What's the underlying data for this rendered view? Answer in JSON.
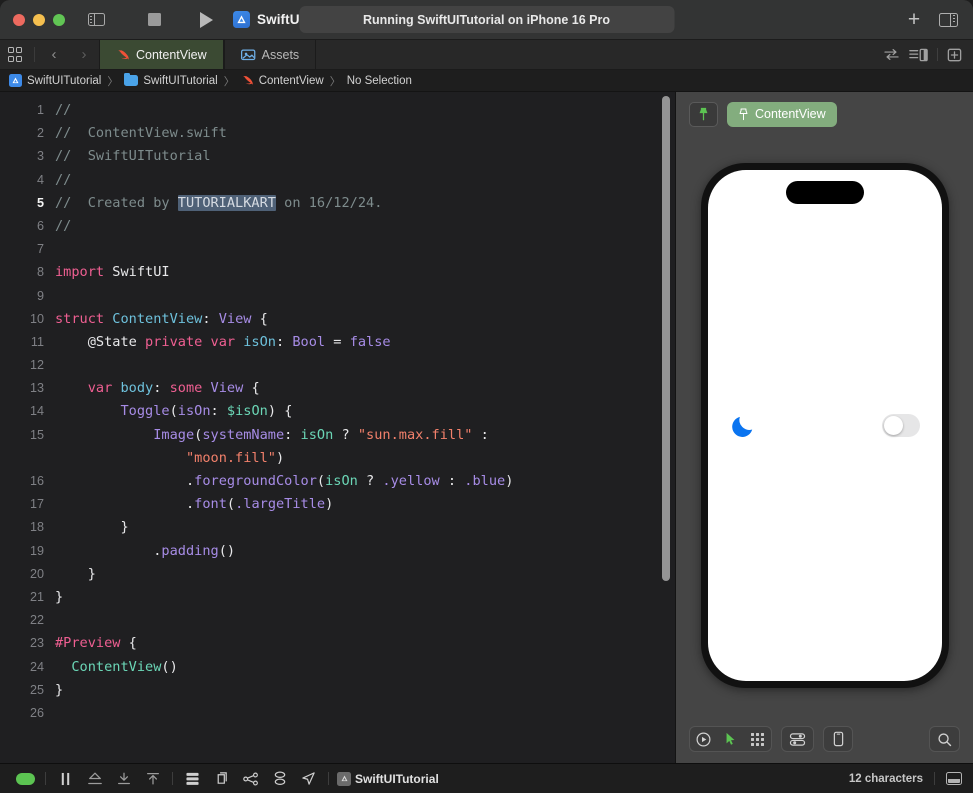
{
  "titlebar": {
    "window_controls": [
      "close",
      "minimize",
      "zoom"
    ],
    "sidebar_toggle": "sidebar-toggle",
    "stop_button": "stop",
    "run_button": "run",
    "scheme_name": "SwiftUITutorial",
    "destination": "iPhone 16 P",
    "status": "Running SwiftUITutorial on iPhone 16 Pro",
    "add_button": "+",
    "inspector_toggle": "inspector-toggle"
  },
  "tabbar": {
    "back": "‹",
    "forward": "›",
    "tabs": [
      {
        "label": "ContentView",
        "icon": "swift-icon",
        "active": true
      },
      {
        "label": "Assets",
        "icon": "assets-icon",
        "active": false
      }
    ]
  },
  "breadcrumb": {
    "items": [
      "SwiftUITutorial",
      "SwiftUITutorial",
      "ContentView",
      "No Selection"
    ],
    "separator": "〉"
  },
  "editor": {
    "lines": [
      {
        "n": "1",
        "tokens": [
          {
            "t": "//",
            "c": "cm"
          }
        ]
      },
      {
        "n": "2",
        "tokens": [
          {
            "t": "//  ContentView.swift",
            "c": "cm"
          }
        ]
      },
      {
        "n": "3",
        "tokens": [
          {
            "t": "//  SwiftUITutorial",
            "c": "cm"
          }
        ]
      },
      {
        "n": "4",
        "tokens": [
          {
            "t": "//",
            "c": "cm"
          }
        ]
      },
      {
        "n": "5",
        "current": true,
        "tokens": [
          {
            "t": "//  Created by ",
            "c": "cm"
          },
          {
            "t": "TUTORIALKART",
            "c": "cm sel"
          },
          {
            "t": " on 16/12/24.",
            "c": "cm"
          }
        ]
      },
      {
        "n": "6",
        "tokens": [
          {
            "t": "//",
            "c": "cm"
          }
        ]
      },
      {
        "n": "7",
        "tokens": []
      },
      {
        "n": "8",
        "tokens": [
          {
            "t": "import ",
            "c": "kw"
          },
          {
            "t": "SwiftUI",
            "c": "plain"
          }
        ]
      },
      {
        "n": "9",
        "tokens": []
      },
      {
        "n": "10",
        "tokens": [
          {
            "t": "struct ",
            "c": "kw"
          },
          {
            "t": "ContentView",
            "c": "type"
          },
          {
            "t": ": ",
            "c": "plain"
          },
          {
            "t": "View",
            "c": "type2"
          },
          {
            "t": " {",
            "c": "plain"
          }
        ]
      },
      {
        "n": "11",
        "tokens": [
          {
            "t": "    @State ",
            "c": "plain"
          },
          {
            "t": "private var ",
            "c": "kw"
          },
          {
            "t": "isOn",
            "c": "type"
          },
          {
            "t": ": ",
            "c": "plain"
          },
          {
            "t": "Bool",
            "c": "type2"
          },
          {
            "t": " = ",
            "c": "plain"
          },
          {
            "t": "false",
            "c": "type2"
          }
        ]
      },
      {
        "n": "12",
        "tokens": []
      },
      {
        "n": "13",
        "tokens": [
          {
            "t": "    ",
            "c": "plain"
          },
          {
            "t": "var ",
            "c": "kw"
          },
          {
            "t": "body",
            "c": "type"
          },
          {
            "t": ": ",
            "c": "plain"
          },
          {
            "t": "some ",
            "c": "kw"
          },
          {
            "t": "View",
            "c": "type2"
          },
          {
            "t": " {",
            "c": "plain"
          }
        ]
      },
      {
        "n": "14",
        "tokens": [
          {
            "t": "        ",
            "c": "plain"
          },
          {
            "t": "Toggle",
            "c": "type2"
          },
          {
            "t": "(",
            "c": "plain"
          },
          {
            "t": "isOn",
            "c": "fn"
          },
          {
            "t": ": ",
            "c": "plain"
          },
          {
            "t": "$isOn",
            "c": "prop"
          },
          {
            "t": ") {",
            "c": "plain"
          }
        ]
      },
      {
        "n": "15",
        "tokens": [
          {
            "t": "            ",
            "c": "plain"
          },
          {
            "t": "Image",
            "c": "type2"
          },
          {
            "t": "(",
            "c": "plain"
          },
          {
            "t": "systemName",
            "c": "fn"
          },
          {
            "t": ": ",
            "c": "plain"
          },
          {
            "t": "isOn",
            "c": "prop"
          },
          {
            "t": " ? ",
            "c": "plain"
          },
          {
            "t": "\"sun.max.fill\"",
            "c": "str"
          },
          {
            "t": " :",
            "c": "plain"
          }
        ]
      },
      {
        "n": "",
        "tokens": [
          {
            "t": "                ",
            "c": "plain"
          },
          {
            "t": "\"moon.fill\"",
            "c": "str"
          },
          {
            "t": ")",
            "c": "plain"
          }
        ]
      },
      {
        "n": "16",
        "tokens": [
          {
            "t": "                .",
            "c": "plain"
          },
          {
            "t": "foregroundColor",
            "c": "fn"
          },
          {
            "t": "(",
            "c": "plain"
          },
          {
            "t": "isOn",
            "c": "prop"
          },
          {
            "t": " ? ",
            "c": "plain"
          },
          {
            "t": ".yellow",
            "c": "type2"
          },
          {
            "t": " : ",
            "c": "plain"
          },
          {
            "t": ".blue",
            "c": "type2"
          },
          {
            "t": ")",
            "c": "plain"
          }
        ]
      },
      {
        "n": "17",
        "tokens": [
          {
            "t": "                .",
            "c": "plain"
          },
          {
            "t": "font",
            "c": "fn"
          },
          {
            "t": "(",
            "c": "plain"
          },
          {
            "t": ".largeTitle",
            "c": "type2"
          },
          {
            "t": ")",
            "c": "plain"
          }
        ]
      },
      {
        "n": "18",
        "tokens": [
          {
            "t": "        }",
            "c": "plain"
          }
        ]
      },
      {
        "n": "19",
        "tokens": [
          {
            "t": "            .",
            "c": "plain"
          },
          {
            "t": "padding",
            "c": "fn"
          },
          {
            "t": "()",
            "c": "plain"
          }
        ]
      },
      {
        "n": "20",
        "tokens": [
          {
            "t": "    }",
            "c": "plain"
          }
        ]
      },
      {
        "n": "21",
        "tokens": [
          {
            "t": "}",
            "c": "plain"
          }
        ]
      },
      {
        "n": "22",
        "tokens": []
      },
      {
        "n": "23",
        "tokens": [
          {
            "t": "#Preview",
            "c": "kw"
          },
          {
            "t": " {",
            "c": "plain"
          }
        ]
      },
      {
        "n": "24",
        "tokens": [
          {
            "t": "  ",
            "c": "plain"
          },
          {
            "t": "ContentView",
            "c": "prop"
          },
          {
            "t": "()",
            "c": "plain"
          }
        ]
      },
      {
        "n": "25",
        "tokens": [
          {
            "t": "}",
            "c": "plain"
          }
        ]
      },
      {
        "n": "26",
        "tokens": []
      }
    ]
  },
  "preview": {
    "pin_button": "pin",
    "pill_label": "ContentView",
    "device_content": {
      "icon": "moon-icon",
      "icon_color": "#0a74f0",
      "toggle_state": "off"
    },
    "toolbar": {
      "live_button": "live-preview",
      "select_button": "selectable",
      "variants_button": "variants",
      "device_settings_button": "device-settings",
      "device_button": "device",
      "search_button": "search"
    }
  },
  "bottombar": {
    "buttons": [
      "continue",
      "pause",
      "step-over",
      "step-into",
      "step-out",
      "view-hierarchy",
      "memory-graph",
      "view-debugger",
      "location"
    ],
    "process_label": "SwiftUITutorial",
    "char_count": "12 characters",
    "console_toggle": "console-toggle"
  },
  "colors": {
    "accent_green": "#83ad7e",
    "tab_active_bg": "#3b4a33",
    "editor_bg": "#1f1f21",
    "preview_bg": "#454545",
    "selection": "#4f6177",
    "moon_blue": "#0a74f0",
    "run_green": "#5cc452"
  }
}
